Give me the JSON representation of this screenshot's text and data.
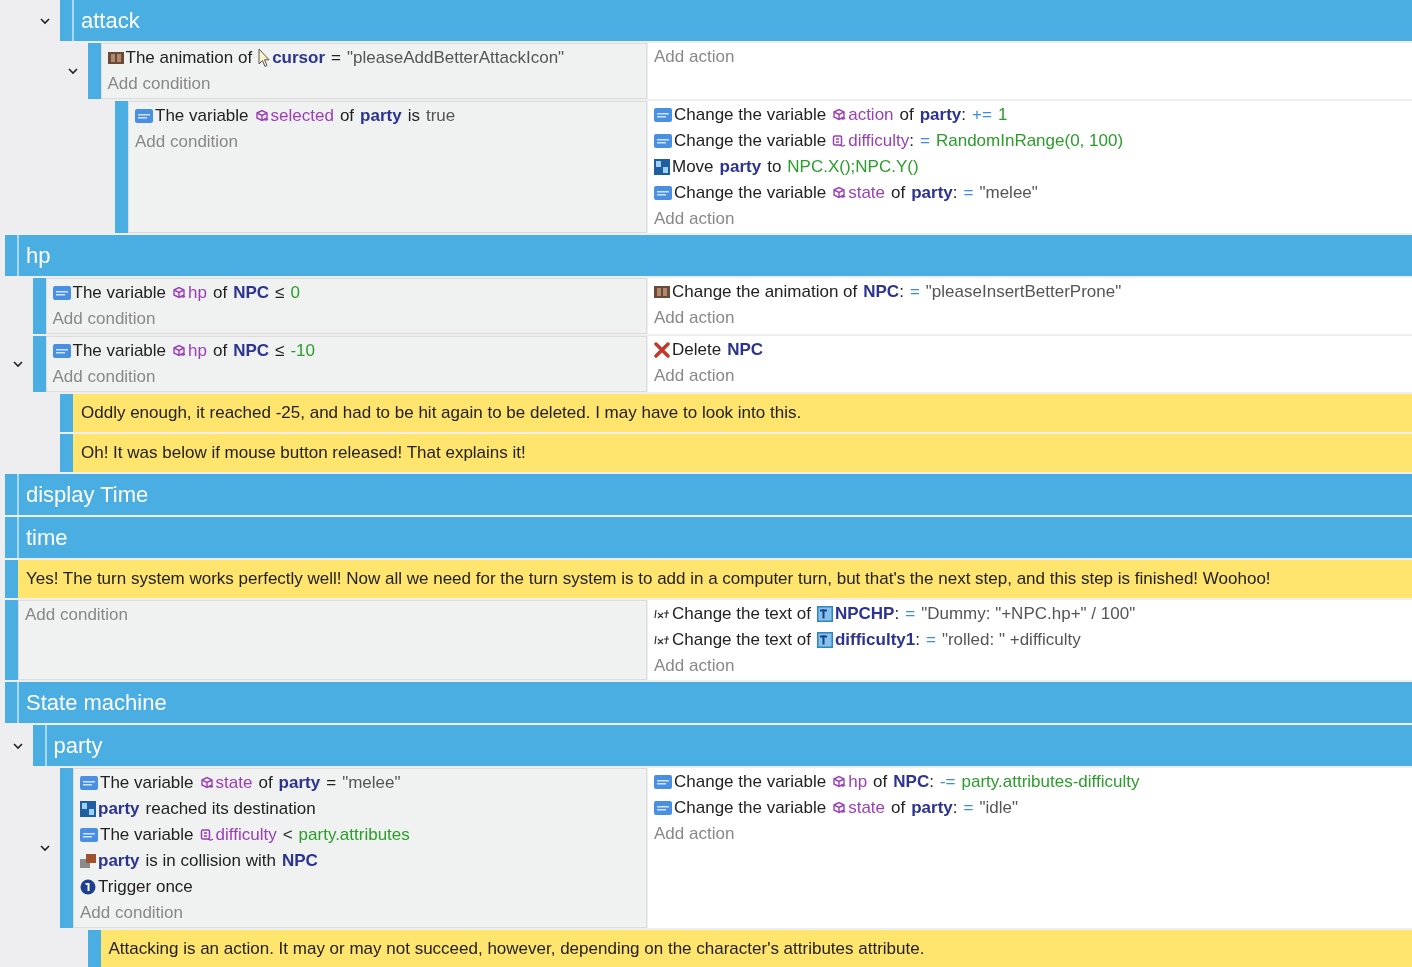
{
  "events": [
    {
      "kind": "offscreen",
      "children": [
        {
          "kind": "offscreen",
          "children": [
            {
              "kind": "group",
              "title": "attack",
              "expanded": true,
              "children": [
                {
                  "kind": "event",
                  "expanded": true,
                  "add_condition": "Add condition",
                  "add_action": "Add action",
                  "conditions": [
                    {
                      "kind": "animation",
                      "parts": [
                        {
                          "kind": "text",
                          "v": "The animation of"
                        },
                        {
                          "kind": "cursorobject",
                          "v": "cursor"
                        },
                        {
                          "kind": "text",
                          "v": "="
                        },
                        {
                          "kind": "string",
                          "v": "\"pleaseAddBetterAttackIcon\""
                        }
                      ]
                    }
                  ],
                  "children": [
                    {
                      "kind": "event",
                      "add_condition": "Add condition",
                      "add_action": "Add action",
                      "conditions": [
                        {
                          "kind": "variable",
                          "parts": [
                            {
                              "kind": "text",
                              "v": "The variable"
                            },
                            {
                              "kind": "objvar",
                              "v": "selected"
                            },
                            {
                              "kind": "text",
                              "v": "of"
                            },
                            {
                              "kind": "object",
                              "v": "party"
                            },
                            {
                              "kind": "text",
                              "v": "is"
                            },
                            {
                              "kind": "string",
                              "v": "true"
                            }
                          ]
                        }
                      ],
                      "actions": [
                        {
                          "kind": "variable",
                          "parts": [
                            {
                              "kind": "text",
                              "v": "Change the variable"
                            },
                            {
                              "kind": "objvar",
                              "v": "action"
                            },
                            {
                              "kind": "text",
                              "v": "of"
                            },
                            {
                              "kind": "object",
                              "v": "party"
                            },
                            {
                              "kind": "colon",
                              "v": ":"
                            },
                            {
                              "kind": "op",
                              "v": "+="
                            },
                            {
                              "kind": "value",
                              "v": "1"
                            }
                          ]
                        },
                        {
                          "kind": "variable",
                          "parts": [
                            {
                              "kind": "text",
                              "v": "Change the variable"
                            },
                            {
                              "kind": "scenevar",
                              "v": "difficulty"
                            },
                            {
                              "kind": "colon",
                              "v": ":"
                            },
                            {
                              "kind": "op",
                              "v": "="
                            },
                            {
                              "kind": "value",
                              "v": "RandomInRange(0, 100)"
                            }
                          ]
                        },
                        {
                          "kind": "move",
                          "parts": [
                            {
                              "kind": "text",
                              "v": "Move"
                            },
                            {
                              "kind": "object",
                              "v": "party"
                            },
                            {
                              "kind": "text",
                              "v": "to"
                            },
                            {
                              "kind": "value",
                              "v": "NPC.X();NPC.Y()"
                            }
                          ]
                        },
                        {
                          "kind": "variable",
                          "parts": [
                            {
                              "kind": "text",
                              "v": "Change the variable"
                            },
                            {
                              "kind": "objvar",
                              "v": "state"
                            },
                            {
                              "kind": "text",
                              "v": "of"
                            },
                            {
                              "kind": "object",
                              "v": "party"
                            },
                            {
                              "kind": "colon",
                              "v": ":"
                            },
                            {
                              "kind": "op",
                              "v": "="
                            },
                            {
                              "kind": "string",
                              "v": "\"melee\""
                            }
                          ]
                        }
                      ]
                    }
                  ]
                }
              ]
            }
          ]
        }
      ]
    },
    {
      "kind": "group",
      "title": "hp",
      "children": [
        {
          "kind": "event",
          "add_condition": "Add condition",
          "add_action": "Add action",
          "conditions": [
            {
              "kind": "variable",
              "parts": [
                {
                  "kind": "text",
                  "v": "The variable"
                },
                {
                  "kind": "objvar",
                  "v": "hp"
                },
                {
                  "kind": "text",
                  "v": "of"
                },
                {
                  "kind": "object",
                  "v": "NPC"
                },
                {
                  "kind": "text",
                  "v": "≤"
                },
                {
                  "kind": "value",
                  "v": "0"
                }
              ]
            }
          ],
          "actions": [
            {
              "kind": "animation",
              "parts": [
                {
                  "kind": "text",
                  "v": "Change the animation of"
                },
                {
                  "kind": "object",
                  "v": "NPC"
                },
                {
                  "kind": "colon",
                  "v": ":"
                },
                {
                  "kind": "op",
                  "v": "="
                },
                {
                  "kind": "string",
                  "v": "\"pleaseInsertBetterProne\""
                }
              ]
            }
          ]
        },
        {
          "kind": "event",
          "expanded": true,
          "add_condition": "Add condition",
          "add_action": "Add action",
          "conditions": [
            {
              "kind": "variable",
              "parts": [
                {
                  "kind": "text",
                  "v": "The variable"
                },
                {
                  "kind": "objvar",
                  "v": "hp"
                },
                {
                  "kind": "text",
                  "v": "of"
                },
                {
                  "kind": "object",
                  "v": "NPC"
                },
                {
                  "kind": "text",
                  "v": "≤"
                },
                {
                  "kind": "value",
                  "v": "-10"
                }
              ]
            }
          ],
          "actions": [
            {
              "kind": "delete",
              "parts": [
                {
                  "kind": "text",
                  "v": "Delete"
                },
                {
                  "kind": "object",
                  "v": "NPC"
                }
              ]
            }
          ],
          "children": [
            {
              "kind": "comment",
              "text": "Oddly enough, it reached -25, and had to be hit again to be deleted. I may have to look into this."
            },
            {
              "kind": "comment",
              "text": "Oh! It was below if mouse button released! That explains it!"
            }
          ]
        }
      ]
    },
    {
      "kind": "group",
      "title": "display Time"
    },
    {
      "kind": "group",
      "title": "time"
    },
    {
      "kind": "comment",
      "text": "Yes! The turn system works perfectly well! Now all we need for the turn system is to add in a computer turn, but that's the next step, and this step is finished! Woohoo!"
    },
    {
      "kind": "event",
      "add_condition": "Add condition",
      "add_action": "Add action",
      "actions": [
        {
          "kind": "text",
          "parts": [
            {
              "kind": "text",
              "v": "Change the text of"
            },
            {
              "kind": "textobject",
              "v": "NPCHP"
            },
            {
              "kind": "colon",
              "v": ":"
            },
            {
              "kind": "op",
              "v": "="
            },
            {
              "kind": "string",
              "v": "\"Dummy: \"+NPC.hp+\" / 100\""
            }
          ]
        },
        {
          "kind": "text",
          "parts": [
            {
              "kind": "text",
              "v": "Change the text of"
            },
            {
              "kind": "textobject",
              "v": "difficulty1"
            },
            {
              "kind": "colon",
              "v": ":"
            },
            {
              "kind": "op",
              "v": "="
            },
            {
              "kind": "string",
              "v": "\"rolled: \" +difficulty"
            }
          ]
        }
      ]
    },
    {
      "kind": "group",
      "title": "State machine",
      "children": [
        {
          "kind": "group",
          "title": "party",
          "expanded": true,
          "children": [
            {
              "kind": "event",
              "expanded": true,
              "add_condition": "Add condition",
              "add_action": "Add action",
              "conditions": [
                {
                  "kind": "variable",
                  "parts": [
                    {
                      "kind": "text",
                      "v": "The variable"
                    },
                    {
                      "kind": "objvar",
                      "v": "state"
                    },
                    {
                      "kind": "text",
                      "v": "of"
                    },
                    {
                      "kind": "object",
                      "v": "party"
                    },
                    {
                      "kind": "text",
                      "v": "="
                    },
                    {
                      "kind": "string",
                      "v": "\"melee\""
                    }
                  ]
                },
                {
                  "kind": "move",
                  "parts": [
                    {
                      "kind": "object",
                      "v": "party"
                    },
                    {
                      "kind": "text",
                      "v": "reached its destination"
                    }
                  ]
                },
                {
                  "kind": "variable",
                  "parts": [
                    {
                      "kind": "text",
                      "v": "The variable"
                    },
                    {
                      "kind": "scenevar",
                      "v": "difficulty"
                    },
                    {
                      "kind": "text",
                      "v": "<"
                    },
                    {
                      "kind": "value",
                      "v": "party.attributes"
                    }
                  ]
                },
                {
                  "kind": "collision",
                  "parts": [
                    {
                      "kind": "object",
                      "v": "party"
                    },
                    {
                      "kind": "text",
                      "v": "is in collision with"
                    },
                    {
                      "kind": "object",
                      "v": "NPC"
                    }
                  ]
                },
                {
                  "kind": "once",
                  "parts": [
                    {
                      "kind": "text",
                      "v": "Trigger once"
                    }
                  ]
                }
              ],
              "actions": [
                {
                  "kind": "variable",
                  "parts": [
                    {
                      "kind": "text",
                      "v": "Change the variable"
                    },
                    {
                      "kind": "objvar",
                      "v": "hp"
                    },
                    {
                      "kind": "text",
                      "v": "of"
                    },
                    {
                      "kind": "object",
                      "v": "NPC"
                    },
                    {
                      "kind": "colon",
                      "v": ":"
                    },
                    {
                      "kind": "op",
                      "v": "-="
                    },
                    {
                      "kind": "value",
                      "v": "party.attributes-difficulty"
                    }
                  ]
                },
                {
                  "kind": "variable",
                  "parts": [
                    {
                      "kind": "text",
                      "v": "Change the variable"
                    },
                    {
                      "kind": "objvar",
                      "v": "state"
                    },
                    {
                      "kind": "text",
                      "v": "of"
                    },
                    {
                      "kind": "object",
                      "v": "party"
                    },
                    {
                      "kind": "colon",
                      "v": ":"
                    },
                    {
                      "kind": "op",
                      "v": "="
                    },
                    {
                      "kind": "string",
                      "v": "\"idle\""
                    }
                  ]
                }
              ],
              "children": [
                {
                  "kind": "comment",
                  "text": "Attacking is an action. It may or may not succeed, however, depending on the character's attributes attribute."
                }
              ]
            }
          ]
        }
      ]
    }
  ]
}
